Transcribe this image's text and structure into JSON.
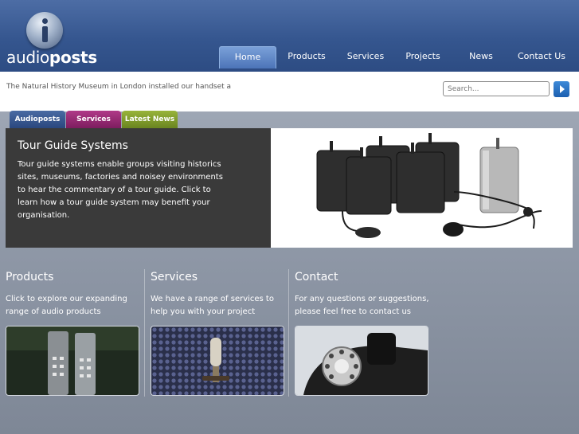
{
  "brand": {
    "name_light": "audio",
    "name_bold": "posts"
  },
  "nav": {
    "items": [
      {
        "label": "Home",
        "active": true
      },
      {
        "label": "Products",
        "active": false
      },
      {
        "label": "Services",
        "active": false
      },
      {
        "label": "Projects",
        "active": false
      },
      {
        "label": "News",
        "active": false
      },
      {
        "label": "Contact Us",
        "active": false
      }
    ]
  },
  "ticker": {
    "text": "The Natural History Museum in London installed our handset a"
  },
  "search": {
    "placeholder": "Search..."
  },
  "tabs": [
    {
      "label": "Audioposts",
      "color": "#2f4d85"
    },
    {
      "label": "Services",
      "color": "#8a2468"
    },
    {
      "label": "Latest News",
      "color": "#7a9428"
    }
  ],
  "feature": {
    "title": "Tour Guide Systems",
    "text": "Tour guide systems enable groups visiting historics sites, museums, factories and noisey environments to hear the commentary of a tour guide. Click to learn how a tour guide system may benefit your organisation."
  },
  "columns": [
    {
      "title": "Products",
      "text": "Click to explore our expanding range of audio products",
      "image": "audio-handsets-photo"
    },
    {
      "title": "Services",
      "text": "We have a range of services to help you with your project",
      "image": "studio-microphone-photo"
    },
    {
      "title": "Contact",
      "text": "For any questions or suggestions, please feel free to contact us",
      "image": "rotary-telephone-photo"
    }
  ],
  "colors": {
    "header": "#35568f",
    "active_nav": "#5a82c4",
    "search_button": "#1c5fb0"
  }
}
